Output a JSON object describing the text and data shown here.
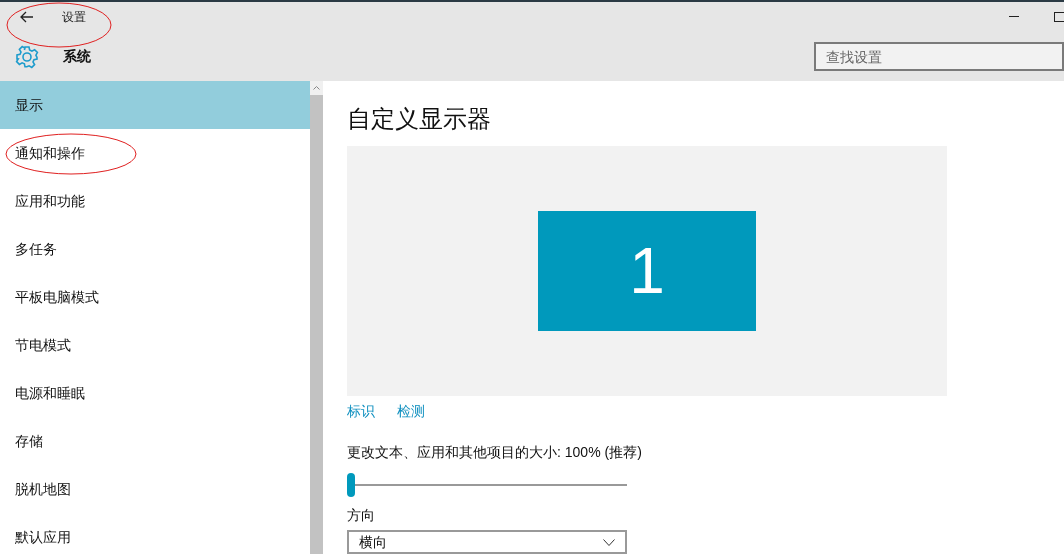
{
  "window": {
    "title": "设置"
  },
  "header": {
    "title": "系统"
  },
  "search": {
    "placeholder": "查找设置"
  },
  "sidebar": {
    "items": [
      {
        "label": "显示",
        "selected": true
      },
      {
        "label": "通知和操作",
        "selected": false
      },
      {
        "label": "应用和功能",
        "selected": false
      },
      {
        "label": "多任务",
        "selected": false
      },
      {
        "label": "平板电脑模式",
        "selected": false
      },
      {
        "label": "节电模式",
        "selected": false
      },
      {
        "label": "电源和睡眠",
        "selected": false
      },
      {
        "label": "存储",
        "selected": false
      },
      {
        "label": "脱机地图",
        "selected": false
      },
      {
        "label": "默认应用",
        "selected": false
      }
    ]
  },
  "content": {
    "heading": "自定义显示器",
    "monitor_number": "1",
    "links": [
      "标识",
      "检测"
    ],
    "scale": {
      "label": "更改文本、应用和其他项目的大小: 100% (推荐)",
      "level": 0
    },
    "orientation": {
      "label": "方向",
      "value": "横向"
    }
  }
}
